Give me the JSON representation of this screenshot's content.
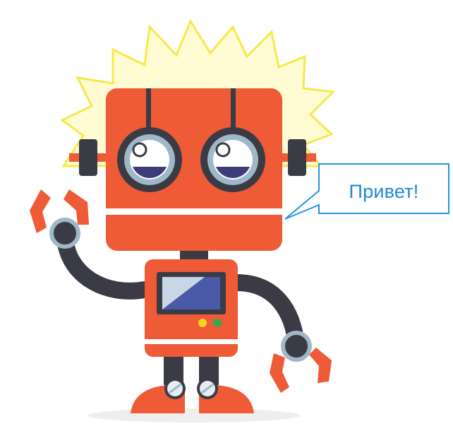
{
  "speech_bubble": {
    "text": "Привет!"
  },
  "colors": {
    "body": "#ef5a37",
    "dark": "#3b3b45",
    "eye_ring": "#9fb8c8",
    "pupil": "#3d3d7c",
    "screen": "#4a5aa8",
    "spark": "#f7e94a",
    "bubble_border": "#2196e0",
    "light_yellow": "#f6d21f",
    "light_green": "#3aa84a"
  },
  "icons": [
    "robot-illustration",
    "speech-bubble",
    "spark-burst"
  ]
}
